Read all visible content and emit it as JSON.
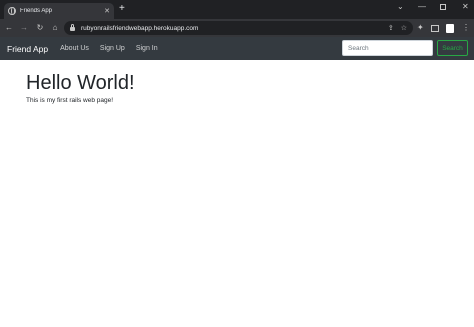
{
  "browser": {
    "tab_title": "Friends App",
    "new_tab": "+",
    "tab_close": "✕",
    "url": "rubyonrailsfriendwebapp.herokuapp.com",
    "controls": {
      "chevron": "⌄",
      "minimize": "—",
      "close": "✕"
    }
  },
  "navbar": {
    "brand": "Friend App",
    "links": [
      "About Us",
      "Sign Up",
      "Sign In"
    ],
    "search_placeholder": "Search",
    "search_button": "Search"
  },
  "main": {
    "heading": "Hello World!",
    "text": "This is my first rails web page!"
  },
  "colors": {
    "navbar_bg": "#343a40",
    "search_accent": "#28a745",
    "browser_frame": "#202124",
    "browser_toolbar": "#35363a"
  }
}
